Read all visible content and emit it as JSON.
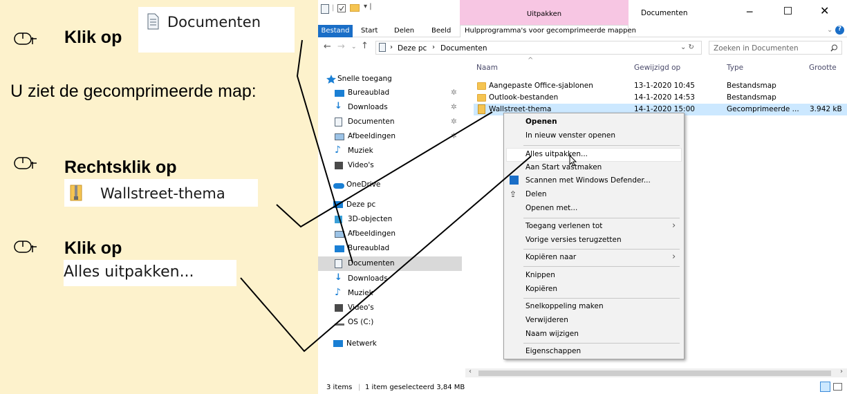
{
  "instructions": {
    "step1_prefix": "Klik op",
    "step1_target": "Documenten",
    "note": "U ziet de gecomprimeerde map:",
    "step2_prefix": "Rechtsklik op",
    "step2_target": "Wallstreet-thema",
    "step3_prefix": "Klik op",
    "step3_target": "Alles uitpakken..."
  },
  "window": {
    "title": "Documenten",
    "contextual_tab": "Uitpakken",
    "contextual_tool": "Hulpprogramma's voor gecomprimeerde mappen",
    "ribbon_tabs": [
      "Bestand",
      "Start",
      "Delen",
      "Beeld"
    ],
    "breadcrumb": [
      "Deze pc",
      "Documenten"
    ],
    "search_placeholder": "Zoeken in Documenten"
  },
  "columns": {
    "name": "Naam",
    "modified": "Gewijzigd op",
    "type": "Type",
    "size": "Grootte"
  },
  "files": [
    {
      "name": "Aangepaste Office-sjablonen",
      "modified": "13-1-2020 10:45",
      "type": "Bestandsmap",
      "size": ""
    },
    {
      "name": "Outlook-bestanden",
      "modified": "14-1-2020 14:53",
      "type": "Bestandsmap",
      "size": ""
    },
    {
      "name": "Wallstreet-thema",
      "modified": "14-1-2020 15:00",
      "type": "Gecomprimeerde ...",
      "size": "3.942 kB"
    }
  ],
  "nav": {
    "quick_access": "Snelle toegang",
    "quick_items": [
      "Bureaublad",
      "Downloads",
      "Documenten",
      "Afbeeldingen",
      "Muziek",
      "Video's"
    ],
    "onedrive": "OneDrive",
    "this_pc": "Deze pc",
    "pc_items": [
      "3D-objecten",
      "Afbeeldingen",
      "Bureaublad",
      "Documenten",
      "Downloads",
      "Muziek",
      "Video's",
      "OS (C:)"
    ],
    "network": "Netwerk"
  },
  "context_menu": {
    "open": "Openen",
    "open_new": "In nieuw venster openen",
    "extract_all": "Alles uitpakken...",
    "pin_start": "Aan Start vastmaken",
    "scan": "Scannen met Windows Defender...",
    "share": "Delen",
    "open_with": "Openen met...",
    "give_access": "Toegang verlenen tot",
    "restore": "Vorige versies terugzetten",
    "send_to": "Kopiëren naar",
    "cut": "Knippen",
    "copy": "Kopiëren",
    "shortcut": "Snelkoppeling maken",
    "delete": "Verwijderen",
    "rename": "Naam wijzigen",
    "properties": "Eigenschappen"
  },
  "status": {
    "items": "3 items",
    "selected": "1 item geselecteerd 3,84 MB"
  },
  "colors": {
    "instruction_bg": "#fdf2cc",
    "file_tab": "#1a6ec7",
    "contextual_tab": "#f7c6e3",
    "selection": "#cce8ff"
  }
}
